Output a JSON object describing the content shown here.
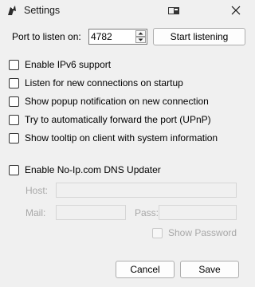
{
  "window": {
    "title": "Settings"
  },
  "port": {
    "label": "Port to listen on:",
    "value": "4782",
    "start_button": "Start listening"
  },
  "options": [
    {
      "label": "Enable IPv6 support",
      "checked": false
    },
    {
      "label": "Listen for new connections on startup",
      "checked": false
    },
    {
      "label": "Show popup notification on new connection",
      "checked": false
    },
    {
      "label": "Try to automatically forward the port (UPnP)",
      "checked": false
    },
    {
      "label": "Show tooltip on client with system information",
      "checked": false
    }
  ],
  "noip": {
    "enable_label": "Enable No-Ip.com DNS Updater",
    "host_label": "Host:",
    "mail_label": "Mail:",
    "pass_label": "Pass:",
    "show_password_label": "Show Password"
  },
  "footer": {
    "cancel": "Cancel",
    "save": "Save"
  },
  "icons": {
    "app": "app-icon",
    "restore": "restore-icon",
    "close": "close-icon",
    "spin_up": "chevron-up-icon",
    "spin_down": "chevron-down-icon"
  }
}
